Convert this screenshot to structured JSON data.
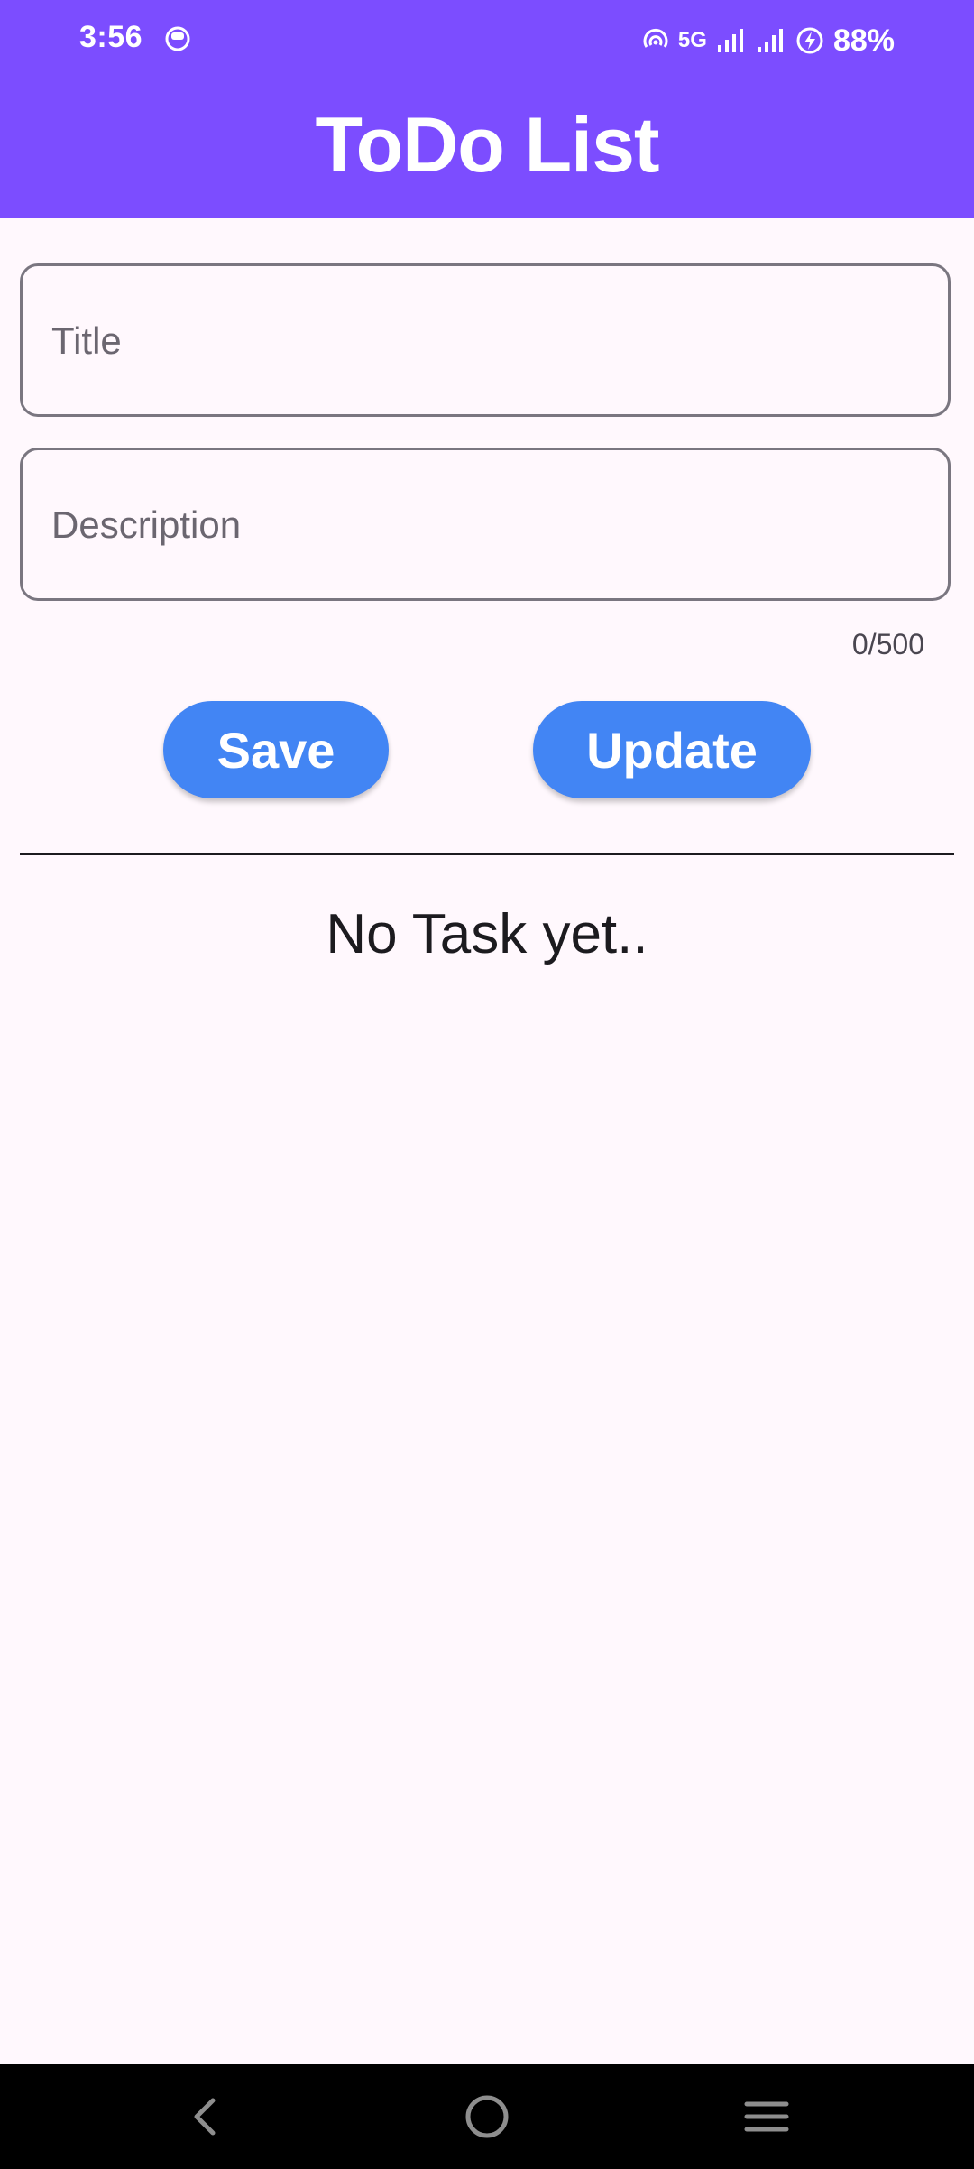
{
  "status_bar": {
    "time": "3:56",
    "network": "5G",
    "battery": "88%"
  },
  "header": {
    "title": "ToDo List"
  },
  "form": {
    "title_placeholder": "Title",
    "title_value": "",
    "description_placeholder": "Description",
    "description_value": "",
    "counter": "0/500"
  },
  "buttons": {
    "save": "Save",
    "update": "Update"
  },
  "tasks": {
    "empty_text": "No Task yet.."
  },
  "colors": {
    "app_bar": "#7C4DFF",
    "button": "#4285F4",
    "background": "#FFF8FD"
  },
  "nav": {
    "back_icon": "back-chevron-icon",
    "home_icon": "home-circle-icon",
    "menu_icon": "menu-lines-icon"
  }
}
